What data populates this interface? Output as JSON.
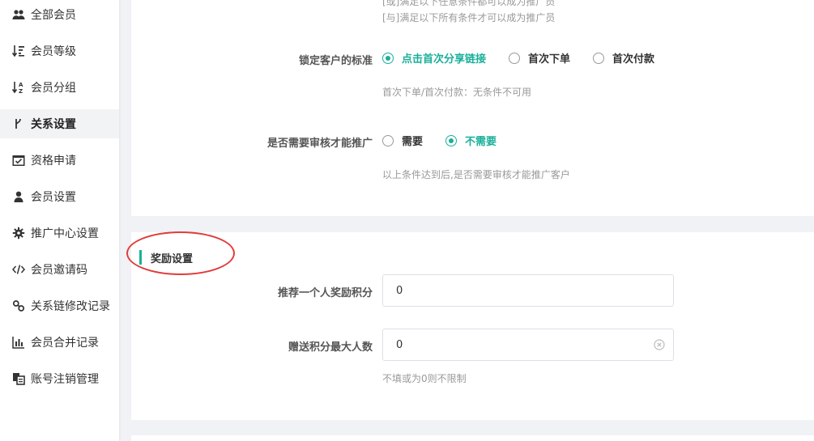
{
  "sidebar": {
    "items": [
      {
        "label": "全部会员",
        "icon": "users-icon"
      },
      {
        "label": "会员等级",
        "icon": "sort-level-icon"
      },
      {
        "label": "会员分组",
        "icon": "sort-group-icon"
      },
      {
        "label": "关系设置",
        "icon": "branch-icon",
        "active": true
      },
      {
        "label": "资格申请",
        "icon": "calendar-check-icon"
      },
      {
        "label": "会员设置",
        "icon": "user-icon"
      },
      {
        "label": "推广中心设置",
        "icon": "gear-icon"
      },
      {
        "label": "会员邀请码",
        "icon": "code-icon"
      },
      {
        "label": "关系链修改记录",
        "icon": "link-icon"
      },
      {
        "label": "会员合并记录",
        "icon": "bar-chart-icon"
      },
      {
        "label": "账号注销管理",
        "icon": "copy-icon"
      }
    ]
  },
  "relation": {
    "condition_hint_1": "[或]满足以下任意条件都可以成为推广员",
    "condition_hint_2": "[与]满足以下所有条件才可以成为推广员",
    "lock_label": "锁定客户的标准",
    "lock_options": [
      "点击首次分享链接",
      "首次下单",
      "首次付款"
    ],
    "lock_selected": 0,
    "lock_hint": "首次下单/首次付款：无条件不可用",
    "audit_label": "是否需要审核才能推广",
    "audit_options": [
      "需要",
      "不需要"
    ],
    "audit_selected": 1,
    "audit_hint": "以上条件达到后,是否需要审核才能推广客户"
  },
  "reward": {
    "title": "奖励设置",
    "per_person_label": "推荐一个人奖励积分",
    "per_person_value": "0",
    "max_people_label": "赠送积分最大人数",
    "max_people_value": "0",
    "max_people_hint": "不填或为0则不限制"
  },
  "colors": {
    "accent": "#1aaf9a",
    "annotation": "#e23b3b"
  }
}
